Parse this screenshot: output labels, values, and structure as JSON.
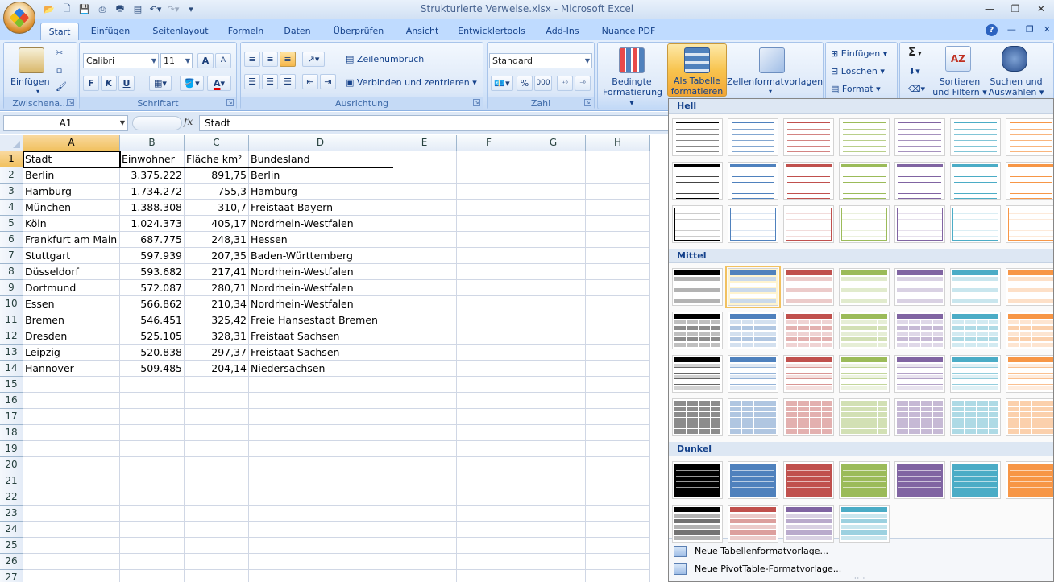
{
  "window": {
    "title": "Strukturierte Verweise.xlsx - Microsoft Excel",
    "minimize": "—",
    "maximize": "❐",
    "close": "✕"
  },
  "tabs": [
    {
      "label": "Start",
      "active": true
    },
    {
      "label": "Einfügen"
    },
    {
      "label": "Seitenlayout"
    },
    {
      "label": "Formeln"
    },
    {
      "label": "Daten"
    },
    {
      "label": "Überprüfen"
    },
    {
      "label": "Ansicht"
    },
    {
      "label": "Entwicklertools"
    },
    {
      "label": "Add-Ins"
    },
    {
      "label": "Nuance PDF"
    }
  ],
  "ribbon": {
    "clipboard": {
      "label": "Zwischena...",
      "paste": "Einfügen"
    },
    "font": {
      "label": "Schriftart",
      "name": "Calibri",
      "size": "11",
      "bold": "F",
      "italic": "K",
      "underline": "U",
      "grow": "A",
      "shrink": "A",
      "color": "A"
    },
    "alignment": {
      "label": "Ausrichtung",
      "wrap": "Zeilenumbruch",
      "merge": "Verbinden und zentrieren"
    },
    "number": {
      "label": "Zahl",
      "format": "Standard",
      "percent": "%",
      "thousands": "000"
    },
    "styles": {
      "conditional_1": "Bedingte",
      "conditional_2": "Formatierung",
      "as_table_1": "Als Tabelle",
      "as_table_2": "formatieren",
      "cell_styles": "Zellenformatvorlagen"
    },
    "cells": {
      "insert": "Einfügen",
      "delete": "Löschen",
      "format": "Format"
    },
    "editing": {
      "sigma": "Σ",
      "sort_1": "Sortieren",
      "sort_2": "und Filtern",
      "find_1": "Suchen und",
      "find_2": "Auswählen"
    }
  },
  "formula_bar": {
    "name_box": "A1",
    "fx": "fx",
    "value": "Stadt"
  },
  "sheet": {
    "columns": [
      "A",
      "B",
      "C",
      "D",
      "E",
      "F",
      "G",
      "H"
    ],
    "selected_column": "A",
    "selected_row": "1",
    "header": [
      "Stadt",
      "Einwohner",
      "Fläche km²",
      "Bundesland"
    ],
    "rows": [
      [
        "Berlin",
        "3.375.222",
        "891,75",
        "Berlin"
      ],
      [
        "Hamburg",
        "1.734.272",
        "755,3",
        "Hamburg"
      ],
      [
        "München",
        "1.388.308",
        "310,7",
        "Freistaat Bayern"
      ],
      [
        "Köln",
        "1.024.373",
        "405,17",
        "Nordrhein-Westfalen"
      ],
      [
        "Frankfurt am Main",
        "687.775",
        "248,31",
        "Hessen"
      ],
      [
        "Stuttgart",
        "597.939",
        "207,35",
        "Baden-Württemberg"
      ],
      [
        "Düsseldorf",
        "593.682",
        "217,41",
        "Nordrhein-Westfalen"
      ],
      [
        "Dortmund",
        "572.087",
        "280,71",
        "Nordrhein-Westfalen"
      ],
      [
        "Essen",
        "566.862",
        "210,34",
        "Nordrhein-Westfalen"
      ],
      [
        "Bremen",
        "546.451",
        "325,42",
        "Freie Hansestadt Bremen"
      ],
      [
        "Dresden",
        "525.105",
        "328,31",
        "Freistaat Sachsen"
      ],
      [
        "Leipzig",
        "520.838",
        "297,37",
        "Freistaat Sachsen"
      ],
      [
        "Hannover",
        "509.485",
        "204,14",
        "Niedersachsen"
      ]
    ],
    "row_numbers": [
      "1",
      "2",
      "3",
      "4",
      "5",
      "6",
      "7",
      "8",
      "9",
      "10",
      "11",
      "12",
      "13",
      "14",
      "15",
      "16",
      "17",
      "18",
      "19",
      "20",
      "21",
      "22",
      "23",
      "24",
      "25",
      "26",
      "27"
    ]
  },
  "gallery": {
    "sections": [
      {
        "label": "Hell",
        "rows": 3
      },
      {
        "label": "Mittel",
        "rows": 4
      },
      {
        "label": "Dunkel",
        "rows": 2
      }
    ],
    "palette": [
      "#000000",
      "#4f81bd",
      "#c0504d",
      "#9bbb59",
      "#8064a2",
      "#4bacc6",
      "#f79646"
    ],
    "selected": "Mittel 2",
    "footer": {
      "new_table_style": "Neue Tabellenformatvorlage...",
      "new_pivot_style": "Neue PivotTable-Formatvorlage..."
    }
  }
}
